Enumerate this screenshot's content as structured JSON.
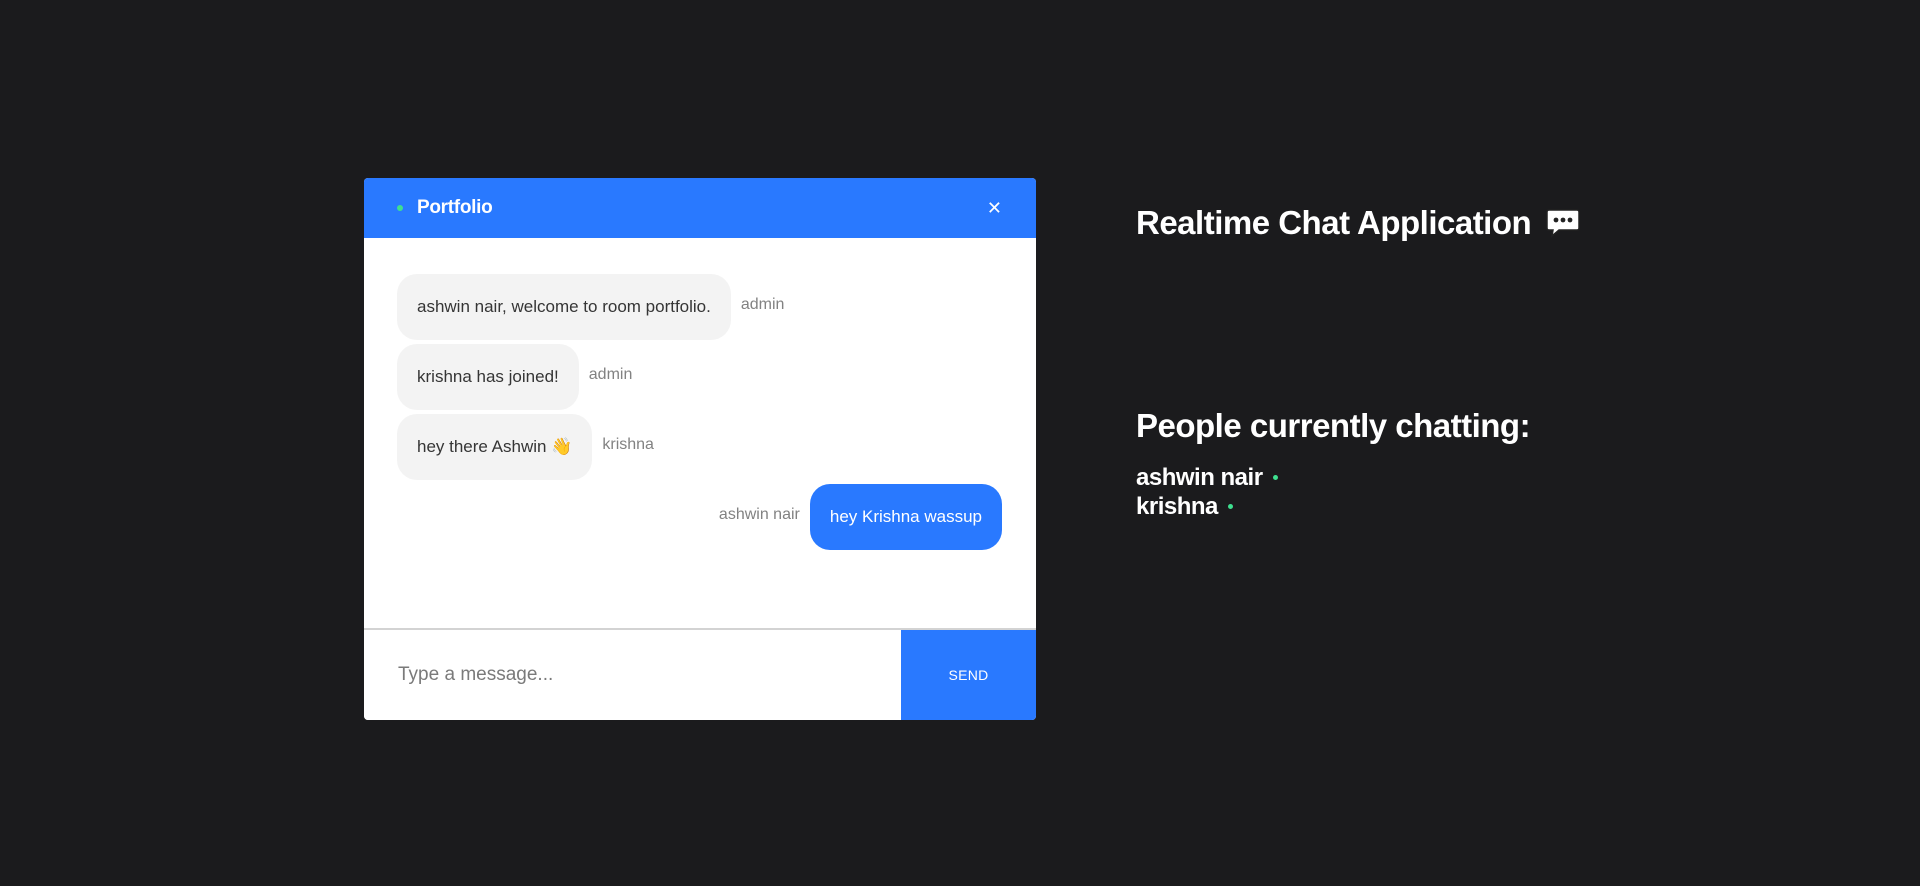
{
  "room": {
    "name": "Portfolio",
    "close_label": "✕"
  },
  "messages": [
    {
      "text": "ashwin nair, welcome to room portfolio.",
      "sender": "admin",
      "mine": false
    },
    {
      "text": "krishna has joined!",
      "sender": "admin",
      "mine": false
    },
    {
      "text": "hey there Ashwin 👋",
      "sender": "krishna",
      "mine": false
    },
    {
      "text": "hey Krishna wassup",
      "sender": "ashwin nair",
      "mine": true
    }
  ],
  "composer": {
    "placeholder": "Type a message...",
    "send_label": "SEND"
  },
  "info": {
    "title": "Realtime Chat Application",
    "title_icon": "speech-bubble-icon",
    "people_heading": "People currently chatting:",
    "people": [
      "ashwin nair",
      "krishna"
    ]
  },
  "colors": {
    "background": "#1b1b1d",
    "accent": "#2979ff",
    "online": "#3ee08f",
    "bubble_other": "#f3f3f3"
  }
}
